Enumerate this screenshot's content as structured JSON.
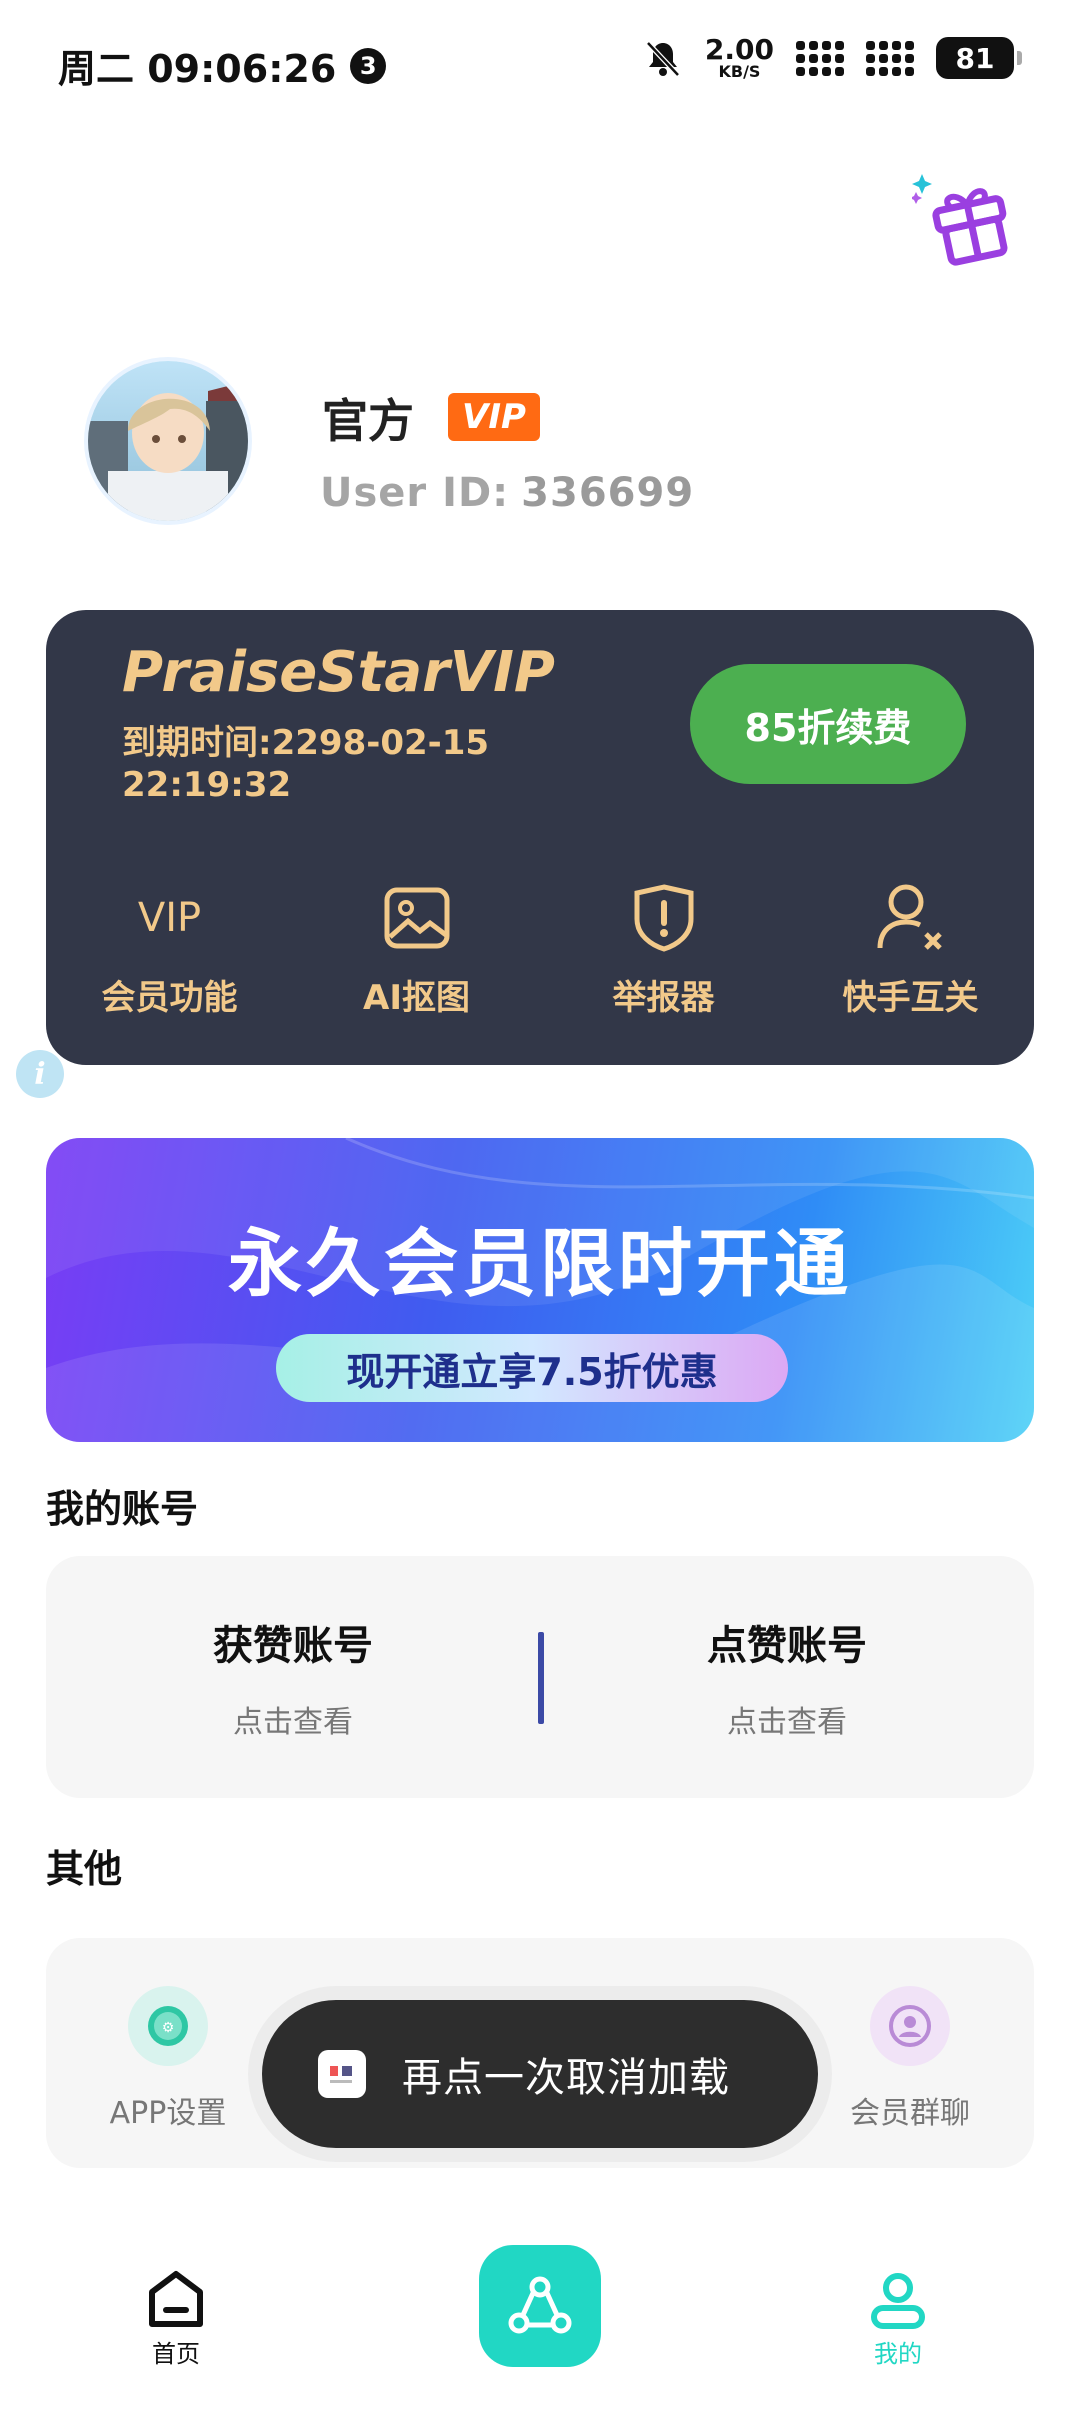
{
  "status_bar": {
    "time": "周二 09:06:26",
    "notification_count": "3",
    "net_speed_value": "2.00",
    "net_speed_unit": "KB/S",
    "battery": "81"
  },
  "profile": {
    "name": "官方",
    "vip_badge": "VIP",
    "user_id_label": "User ID:",
    "user_id": "336699"
  },
  "vip_card": {
    "title": "PraiseStarVIP",
    "expire": "到期时间:2298-02-15 22:19:32",
    "renew_label": "85折续费",
    "items": [
      {
        "icon": "vip-text-icon",
        "icon_text": "VIP",
        "label": "会员功能"
      },
      {
        "icon": "image-icon",
        "label": "AI抠图"
      },
      {
        "icon": "shield-alert-icon",
        "label": "举报器"
      },
      {
        "icon": "user-remove-icon",
        "label": "快手互关"
      }
    ],
    "colors": {
      "background": "#323748",
      "gold": "#f2c98a",
      "renew": "#4caf50"
    }
  },
  "banner": {
    "title": "永久会员限时开通",
    "subtitle": "现开通立享7.5折优惠"
  },
  "my_accounts": {
    "title": "我的账号",
    "items": [
      {
        "title": "获赞账号",
        "sub": "点击查看"
      },
      {
        "title": "点赞账号",
        "sub": "点击查看"
      }
    ]
  },
  "others": {
    "title": "其他",
    "items": [
      {
        "icon": "app-settings-icon",
        "label": "APP设置"
      },
      {
        "icon": "member-group-icon",
        "label": "会员群聊"
      }
    ]
  },
  "toast": {
    "text": "再点一次取消加载"
  },
  "bottom_nav": {
    "home": "首页",
    "mine": "我的",
    "accent": "#21d7c4"
  }
}
